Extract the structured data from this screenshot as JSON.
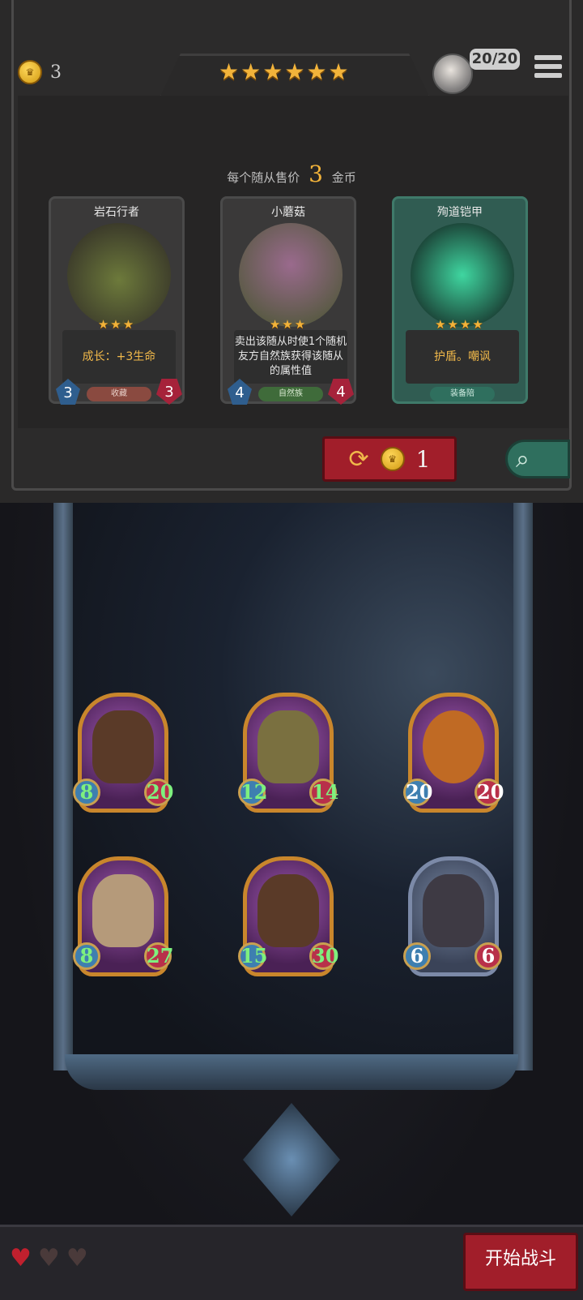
{
  "top_bar": {
    "gold": "3",
    "stars": 6,
    "troops": "20/20"
  },
  "shop": {
    "sell_price_prefix": "每个随从售价",
    "sell_price_value": "3",
    "sell_price_suffix": "金币",
    "refresh_cost": "1",
    "cards": [
      {
        "name": "岩石行者",
        "stars": "★★★",
        "desc": "成长：+3生命",
        "tribe": "收藏",
        "attack": "3",
        "health": "3",
        "desc_color": "#f0b84a",
        "tribe_color": "#8a4a40"
      },
      {
        "name": "小蘑菇",
        "stars": "★★★",
        "desc": "卖出该随从时使1个随机友方自然族获得该随从的属性值",
        "tribe": "自然族",
        "attack": "4",
        "health": "4",
        "desc_color": "#e8e8e8",
        "tribe_color": "#3f6b3a"
      },
      {
        "name": "殉道铠甲",
        "stars": "★★★★",
        "desc": "护盾。嘲讽",
        "tribe": "装备陪",
        "attack": "",
        "health": "",
        "desc_color": "#f0b84a",
        "tribe_color": "#2f6f5e"
      }
    ]
  },
  "board": {
    "minions": [
      {
        "attack": "8",
        "health": "20",
        "attack_color": "#7ef07e",
        "health_color": "#7ef07e"
      },
      {
        "attack": "12",
        "health": "14",
        "attack_color": "#7ef07e",
        "health_color": "#7ef07e"
      },
      {
        "attack": "20",
        "health": "20",
        "attack_color": "#ffffff",
        "health_color": "#ffffff"
      },
      {
        "attack": "8",
        "health": "27",
        "attack_color": "#7ef07e",
        "health_color": "#7ef07e"
      },
      {
        "attack": "15",
        "health": "30",
        "attack_color": "#7ef07e",
        "health_color": "#7ef07e"
      },
      {
        "attack": "6",
        "health": "6",
        "attack_color": "#ffffff",
        "health_color": "#ffffff"
      }
    ]
  },
  "footer": {
    "lives_filled": 1,
    "lives_total": 3,
    "start_battle": "开始战斗"
  }
}
